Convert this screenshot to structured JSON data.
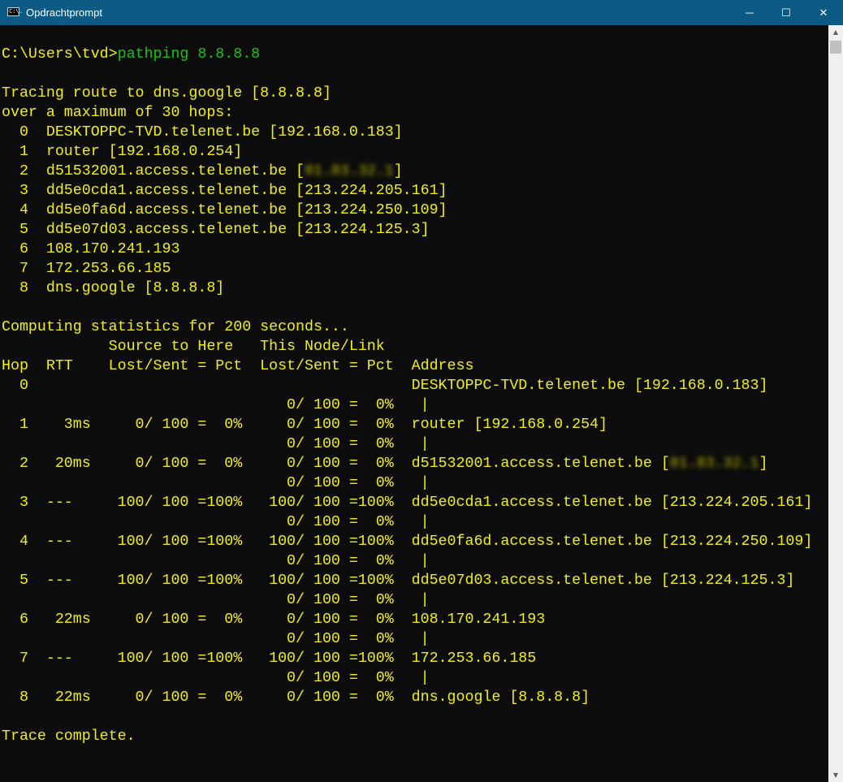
{
  "window": {
    "title": "Opdrachtprompt",
    "icon": "cmd-icon",
    "icon_text": "C:\\."
  },
  "controls": {
    "minimize": "─",
    "maximize": "☐",
    "close": "✕"
  },
  "colors": {
    "yellow": "#f2f200",
    "green": "#16c60c",
    "titlebar": "#0d5a85"
  },
  "lines": [
    [],
    [
      {
        "t": "C:\\Users\\tvd>",
        "c": "y"
      },
      {
        "t": "pathping 8.8.8.8",
        "c": "g"
      }
    ],
    [],
    [
      {
        "t": "Tracing route to dns.google [8.8.8.8]"
      }
    ],
    [
      {
        "t": "over a maximum of 30 hops:"
      }
    ],
    [
      {
        "t": "  0  DESKTOPPC-TVD.telenet.be [192.168.0.183]"
      }
    ],
    [
      {
        "t": "  1  router [192.168.0.254]"
      }
    ],
    [
      {
        "t": "  2  d51532001.access.telenet.be ["
      },
      {
        "t": "81.83.32.1",
        "c": "blur"
      },
      {
        "t": "]"
      }
    ],
    [
      {
        "t": "  3  dd5e0cda1.access.telenet.be [213.224.205.161]"
      }
    ],
    [
      {
        "t": "  4  dd5e0fa6d.access.telenet.be [213.224.250.109]"
      }
    ],
    [
      {
        "t": "  5  dd5e07d03.access.telenet.be [213.224.125.3]"
      }
    ],
    [
      {
        "t": "  6  108.170.241.193"
      }
    ],
    [
      {
        "t": "  7  172.253.66.185"
      }
    ],
    [
      {
        "t": "  8  dns.google [8.8.8.8]"
      }
    ],
    [],
    [
      {
        "t": "Computing statistics for 200 seconds..."
      }
    ],
    [
      {
        "t": "            Source to Here   This Node/Link"
      }
    ],
    [
      {
        "t": "Hop  RTT    Lost/Sent = Pct  Lost/Sent = Pct  Address"
      }
    ],
    [
      {
        "t": "  0                                           DESKTOPPC-TVD.telenet.be [192.168.0.183]"
      }
    ],
    [
      {
        "t": "                                0/ 100 =  0%   |"
      }
    ],
    [
      {
        "t": "  1    3ms     0/ 100 =  0%     0/ 100 =  0%  router [192.168.0.254]"
      }
    ],
    [
      {
        "t": "                                0/ 100 =  0%   |"
      }
    ],
    [
      {
        "t": "  2   20ms     0/ 100 =  0%     0/ 100 =  0%  d51532001.access.telenet.be ["
      },
      {
        "t": "81.83.32.1",
        "c": "blur"
      },
      {
        "t": "]"
      }
    ],
    [
      {
        "t": "                                0/ 100 =  0%   |"
      }
    ],
    [
      {
        "t": "  3  ---     100/ 100 =100%   100/ 100 =100%  dd5e0cda1.access.telenet.be [213.224.205.161]"
      }
    ],
    [
      {
        "t": "                                0/ 100 =  0%   |"
      }
    ],
    [
      {
        "t": "  4  ---     100/ 100 =100%   100/ 100 =100%  dd5e0fa6d.access.telenet.be [213.224.250.109]"
      }
    ],
    [
      {
        "t": "                                0/ 100 =  0%   |"
      }
    ],
    [
      {
        "t": "  5  ---     100/ 100 =100%   100/ 100 =100%  dd5e07d03.access.telenet.be [213.224.125.3]"
      }
    ],
    [
      {
        "t": "                                0/ 100 =  0%   |"
      }
    ],
    [
      {
        "t": "  6   22ms     0/ 100 =  0%     0/ 100 =  0%  108.170.241.193"
      }
    ],
    [
      {
        "t": "                                0/ 100 =  0%   |"
      }
    ],
    [
      {
        "t": "  7  ---     100/ 100 =100%   100/ 100 =100%  172.253.66.185"
      }
    ],
    [
      {
        "t": "                                0/ 100 =  0%   |"
      }
    ],
    [
      {
        "t": "  8   22ms     0/ 100 =  0%     0/ 100 =  0%  dns.google [8.8.8.8]"
      }
    ],
    [],
    [
      {
        "t": "Trace complete."
      }
    ]
  ],
  "scrollbar": {
    "up": "▲",
    "down": "▼"
  }
}
